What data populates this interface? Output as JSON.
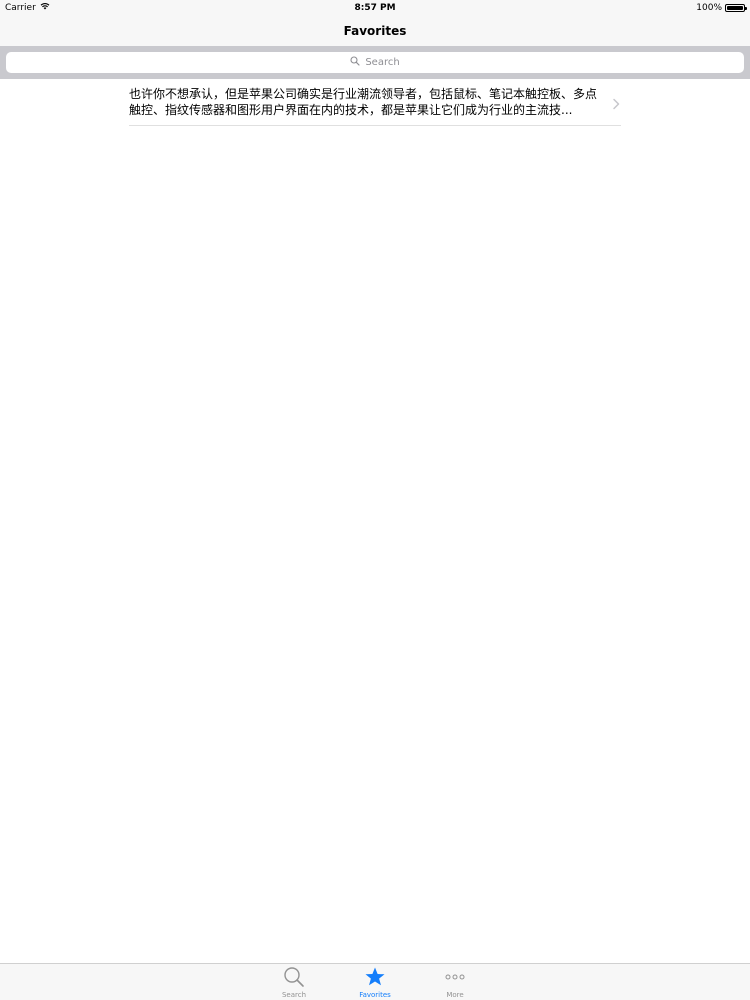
{
  "status_bar": {
    "carrier": "Carrier",
    "time": "8:57 PM",
    "battery_percent": "100%",
    "battery_level": 1.0
  },
  "nav": {
    "title": "Favorites"
  },
  "search": {
    "placeholder": "Search"
  },
  "list": {
    "items": [
      {
        "text": "也许你不想承认，但是苹果公司确实是行业潮流领导者，包括鼠标、笔记本触控板、多点触控、指纹传感器和图形用户界面在内的技术，都是苹果让它们成为行业的主流技..."
      }
    ]
  },
  "tab_bar": {
    "items": [
      {
        "label": "Search",
        "icon": "search-icon",
        "active": false
      },
      {
        "label": "Favorites",
        "icon": "star-icon",
        "active": true
      },
      {
        "label": "More",
        "icon": "more-icon",
        "active": false
      }
    ],
    "active_color": "#147efb",
    "inactive_color": "#929292"
  }
}
